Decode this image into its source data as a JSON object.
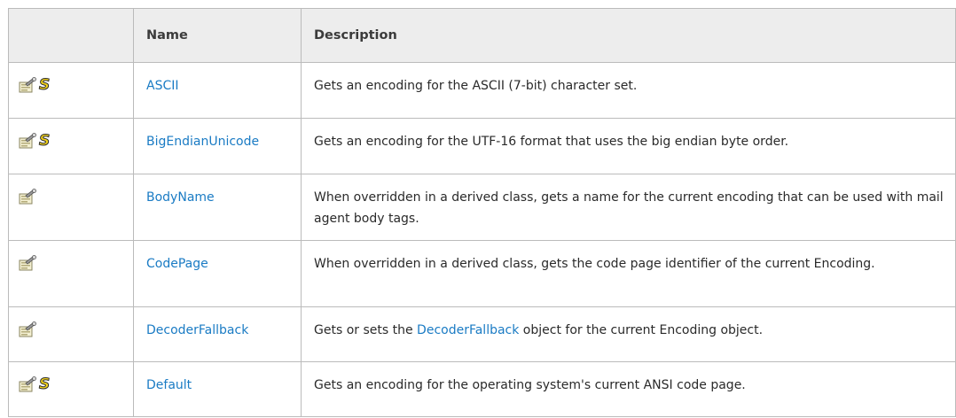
{
  "table": {
    "headers": [
      "",
      "Name",
      "Description"
    ],
    "rows": [
      {
        "icons": [
          "property-icon",
          "static-icon"
        ],
        "name": "ASCII",
        "description": "Gets an encoding for the ASCII (7-bit) character set."
      },
      {
        "icons": [
          "property-icon",
          "static-icon"
        ],
        "name": "BigEndianUnicode",
        "description": "Gets an encoding for the UTF-16 format that uses the big endian byte order."
      },
      {
        "icons": [
          "property-icon"
        ],
        "name": "BodyName",
        "description": "When overridden in a derived class, gets a name for the current encoding that can be used with mail agent body tags."
      },
      {
        "icons": [
          "property-icon"
        ],
        "name": "CodePage",
        "description": "When overridden in a derived class, gets the code page identifier of the current Encoding."
      },
      {
        "icons": [
          "property-icon"
        ],
        "name": "DecoderFallback",
        "description_before": "Gets or sets the ",
        "description_link": "DecoderFallback",
        "description_after": " object for the current Encoding object."
      },
      {
        "icons": [
          "property-icon",
          "static-icon"
        ],
        "name": "Default",
        "description": "Gets an encoding for the operating system's current ANSI code page."
      }
    ],
    "static_icon_glyph": "S"
  },
  "colors": {
    "link": "#1a7bc4",
    "header_bg": "#ededed",
    "border": "#bbbbbb",
    "static_icon": "#f2d21a"
  }
}
